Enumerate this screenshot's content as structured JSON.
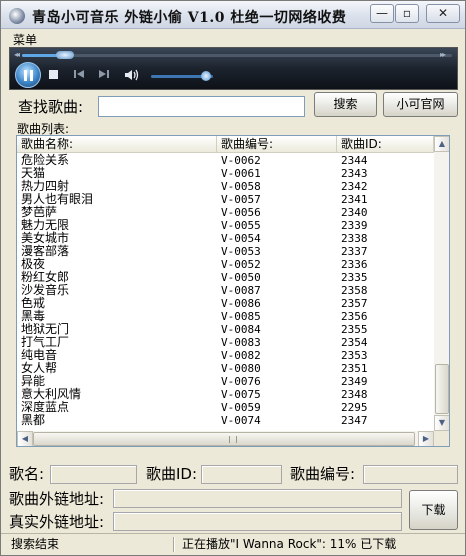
{
  "window": {
    "title": "青岛小可音乐 外链小偷 V1.0 杜绝一切网络收费",
    "min_glyph": "—",
    "max_glyph": "▫",
    "close_glyph": "✕"
  },
  "menu": {
    "label": "菜单"
  },
  "player": {
    "progress": 0.1,
    "volume": 0.88,
    "icons": [
      "pause-icon",
      "stop-icon",
      "prev-icon",
      "next-icon",
      "volume-icon"
    ]
  },
  "search": {
    "label": "查找歌曲:",
    "value": "",
    "button": "搜索",
    "site_button": "小可官网"
  },
  "list": {
    "label": "歌曲列表:",
    "columns": [
      "歌曲名称:",
      "歌曲编号:",
      "歌曲ID:"
    ],
    "rows": [
      [
        "危险关系",
        "V-0062",
        "2344"
      ],
      [
        "天猫",
        "V-0061",
        "2343"
      ],
      [
        "热力四射",
        "V-0058",
        "2342"
      ],
      [
        "男人也有眼泪",
        "V-0057",
        "2341"
      ],
      [
        "梦芭萨",
        "V-0056",
        "2340"
      ],
      [
        "魅力无限",
        "V-0055",
        "2339"
      ],
      [
        "美女城市",
        "V-0054",
        "2338"
      ],
      [
        "漫客部落",
        "V-0053",
        "2337"
      ],
      [
        "极夜",
        "V-0052",
        "2336"
      ],
      [
        "粉红女郎",
        "V-0050",
        "2335"
      ],
      [
        "沙发音乐",
        "V-0087",
        "2358"
      ],
      [
        "色戒",
        "V-0086",
        "2357"
      ],
      [
        "黑毒",
        "V-0085",
        "2356"
      ],
      [
        "地狱无门",
        "V-0084",
        "2355"
      ],
      [
        "打气工厂",
        "V-0083",
        "2354"
      ],
      [
        "纯电音",
        "V-0082",
        "2353"
      ],
      [
        "女人帮",
        "V-0080",
        "2351"
      ],
      [
        "异能",
        "V-0076",
        "2349"
      ],
      [
        "意大利风情",
        "V-0075",
        "2348"
      ],
      [
        "深度蓝点",
        "V-0059",
        "2295"
      ],
      [
        "黑都",
        "V-0074",
        "2347"
      ]
    ]
  },
  "fields": {
    "song_name_label": "歌名:",
    "song_name_value": "",
    "song_id_label": "歌曲ID:",
    "song_id_value": "",
    "song_no_label": "歌曲编号:",
    "song_no_value": "",
    "ext_link_label": "歌曲外链地址:",
    "ext_link_value": "",
    "real_link_label": "真实外链地址:",
    "real_link_value": "",
    "download_button": "下载"
  },
  "status": {
    "left": "搜索结束",
    "right": "正在播放\"I Wanna Rock\": 11% 已下载"
  }
}
